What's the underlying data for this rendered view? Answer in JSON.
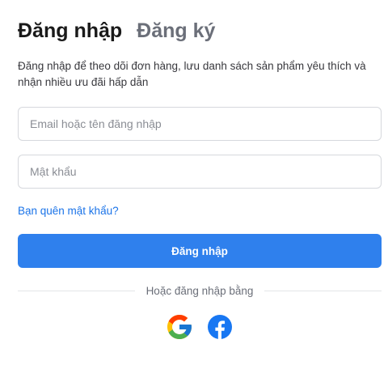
{
  "tabs": [
    {
      "label": "Đăng nhập",
      "active": true
    },
    {
      "label": "Đăng ký",
      "active": false
    }
  ],
  "description": "Đăng nhập để theo dõi đơn hàng, lưu danh sách sản phẩm yêu thích và nhận nhiều ưu đãi hấp dẫn",
  "form": {
    "email_placeholder": "Email hoặc tên đăng nhập",
    "email_value": "",
    "password_placeholder": "Mật khẩu",
    "password_value": "",
    "forgot_label": "Bạn quên mật khẩu?",
    "submit_label": "Đăng nhập"
  },
  "divider_text": "Hoặc đăng nhập bằng",
  "social": [
    {
      "name": "google",
      "icon": "google-icon"
    },
    {
      "name": "facebook",
      "icon": "facebook-icon"
    }
  ],
  "colors": {
    "primary": "#2f80ed",
    "link": "#1a73e8",
    "facebook": "#1877f2"
  }
}
